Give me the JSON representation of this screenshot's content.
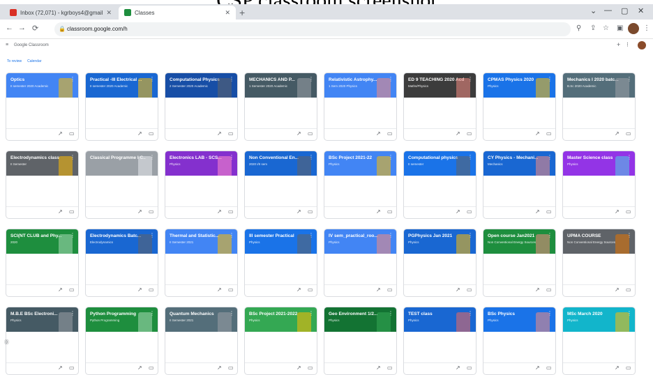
{
  "caption": "CSP classroom screenshot",
  "browser": {
    "tabs": [
      {
        "title": "Inbox (72,071) - kgrboys4@gmail",
        "favicon_color": "#d93025"
      },
      {
        "title": "Classes",
        "favicon_color": "#1e8e3e"
      }
    ],
    "url": "classroom.google.com/h",
    "window_controls": [
      "⌄",
      "—",
      "▢",
      "✕"
    ]
  },
  "app": {
    "title": "Google Classroom",
    "subnav": [
      "To review",
      "Calendar"
    ]
  },
  "cards": [
    {
      "name": "Optics",
      "section": "II semester 2020 Academic",
      "color": "#4285f4",
      "deco": "#fbbc04"
    },
    {
      "name": "Practical -III Electrical ...",
      "section": "II semester 2020 Academic",
      "color": "#1967d2",
      "deco": "#fbbc04"
    },
    {
      "name": "Computational Physics",
      "section": "2 Semester 2020 Academic",
      "color": "#174ea6",
      "deco": "#5f6368"
    },
    {
      "name": "MECHANICS AND P...",
      "section": "1 Semester 2020 Academic",
      "color": "#455a64",
      "deco": "#9aa0a6"
    },
    {
      "name": "Relativistic Astrophy...",
      "section": "1 Sem 2020 Physics",
      "color": "#4285f4",
      "deco": "#f28b82"
    },
    {
      "name": "ED 9 TEACHING 2020 Acd...",
      "section": "Maths/Physics",
      "color": "#3c3c3c",
      "deco": "#f28b82"
    },
    {
      "name": "CPMAS Physics 2020",
      "section": "Physics",
      "color": "#1a73e8",
      "deco": "#fbbc04"
    },
    {
      "name": "Mechanics I 2020 batc...",
      "section": "B.Sc 2020 Academic",
      "color": "#546e7a",
      "deco": "#9aa0a6"
    },
    {
      "name": "Electrodynamics class",
      "section": "II Semester",
      "color": "#5f6368",
      "deco": "#fbbc04"
    },
    {
      "name": "Classical Programme I C...",
      "section": "",
      "color": "#9aa0a6",
      "deco": "#e8eaed"
    },
    {
      "name": "Electronics LAB - SCS...",
      "section": "Physics",
      "color": "#8430ce",
      "deco": "#ff8bcb"
    },
    {
      "name": "Non Conventional En...",
      "section": "2020 I/II sem",
      "color": "#1967d2",
      "deco": "#5f6368"
    },
    {
      "name": "BSc Project 2021-22",
      "section": "Physics",
      "color": "#4285f4",
      "deco": "#fbbc04"
    },
    {
      "name": "Computational physics",
      "section": "II semester",
      "color": "#1a73e8",
      "deco": "#5f6368"
    },
    {
      "name": "CY Physics - Mechani...",
      "section": "Mechanics",
      "color": "#1967d2",
      "deco": "#f28b82"
    },
    {
      "name": "Master Science class",
      "section": "Physics",
      "color": "#9334e6",
      "deco": "#4ecde6"
    },
    {
      "name": "SCI(NT CLUB and Phy...",
      "section": "2020",
      "color": "#1e8e3e",
      "deco": "#a8dab5"
    },
    {
      "name": "Electrodynamics Batc...",
      "section": "Electrodynamics",
      "color": "#1967d2",
      "deco": "#5f6368"
    },
    {
      "name": "Thermal and Statistic...",
      "section": "II Semester 2021",
      "color": "#4285f4",
      "deco": "#fbbc04"
    },
    {
      "name": "III semester Practical",
      "section": "Physics",
      "color": "#1a73e8",
      "deco": "#5f6368"
    },
    {
      "name": "IV sem_practical_roo...",
      "section": "Physics",
      "color": "#4285f4",
      "deco": "#f28b82"
    },
    {
      "name": "PGPhysics Jan 2021",
      "section": "Physics",
      "color": "#1967d2",
      "deco": "#fbbc04"
    },
    {
      "name": "Open course Jan2021",
      "section": "Non Conventional Energy Sources",
      "color": "#1e8e3e",
      "deco": "#f28b82"
    },
    {
      "name": "UPMA COURSE",
      "section": "Non Conventional Energy Sources",
      "color": "#5f6368",
      "deco": "#e37400"
    },
    {
      "name": "M.B.E BSc Electroni...",
      "section": "Physics",
      "color": "#455a64",
      "deco": "#9aa0a6"
    },
    {
      "name": "Python Programming",
      "section": "Python Programming",
      "color": "#1e8e3e",
      "deco": "#a8dab5"
    },
    {
      "name": "Quantum Mechanics",
      "section": "II Semester 2021",
      "color": "#546e7a",
      "deco": "#9aa0a6"
    },
    {
      "name": "BSc Project 2021-2022",
      "section": "Physics",
      "color": "#34a853",
      "deco": "#fbbc04"
    },
    {
      "name": "Geo Environment 1/2...",
      "section": "Physics",
      "color": "#137333",
      "deco": "#34a853"
    },
    {
      "name": "TEST class",
      "section": "Physics",
      "color": "#1967d2",
      "deco": "#ee675c"
    },
    {
      "name": "BSc Physics",
      "section": "Physics",
      "color": "#1a73e8",
      "deco": "#f28b82"
    },
    {
      "name": "MSc March 2020",
      "section": "Physics",
      "color": "#12b5cb",
      "deco": "#fbbc04"
    }
  ]
}
